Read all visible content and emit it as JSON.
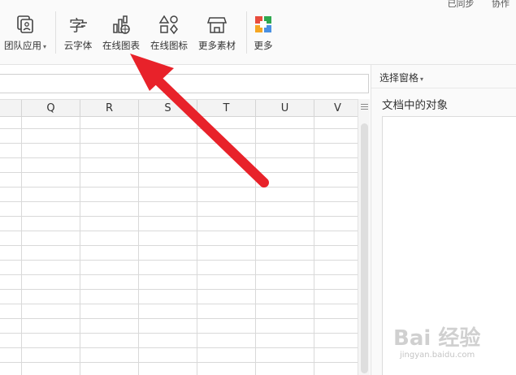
{
  "ribbon": {
    "top_right_texts": [
      "已同步",
      "协作"
    ],
    "tools": [
      {
        "label": "团队应用",
        "icon": "team-apps-icon",
        "has_caret": true
      },
      {
        "label": "云字体",
        "icon": "cloud-font-icon"
      },
      {
        "label": "在线图表",
        "icon": "online-chart-icon"
      },
      {
        "label": "在线图标",
        "icon": "online-icons-icon"
      },
      {
        "label": "更多素材",
        "icon": "more-materials-icon"
      },
      {
        "label": "更多",
        "icon": "more-apps-icon"
      }
    ]
  },
  "sheet": {
    "columns": [
      "Q",
      "R",
      "S",
      "T",
      "U",
      "V"
    ]
  },
  "selection_pane": {
    "title": "选择窗格",
    "subtitle": "文档中的对象"
  },
  "annotation": {
    "arrow_color": "#e8222a"
  },
  "watermark": {
    "main": "Bai 经验",
    "sub": "jingyan.baidu.com"
  },
  "colors": {
    "grid_line": "#d9d9d9",
    "header_bg": "#f3f3f3",
    "ribbon_bg": "#fafafa"
  }
}
